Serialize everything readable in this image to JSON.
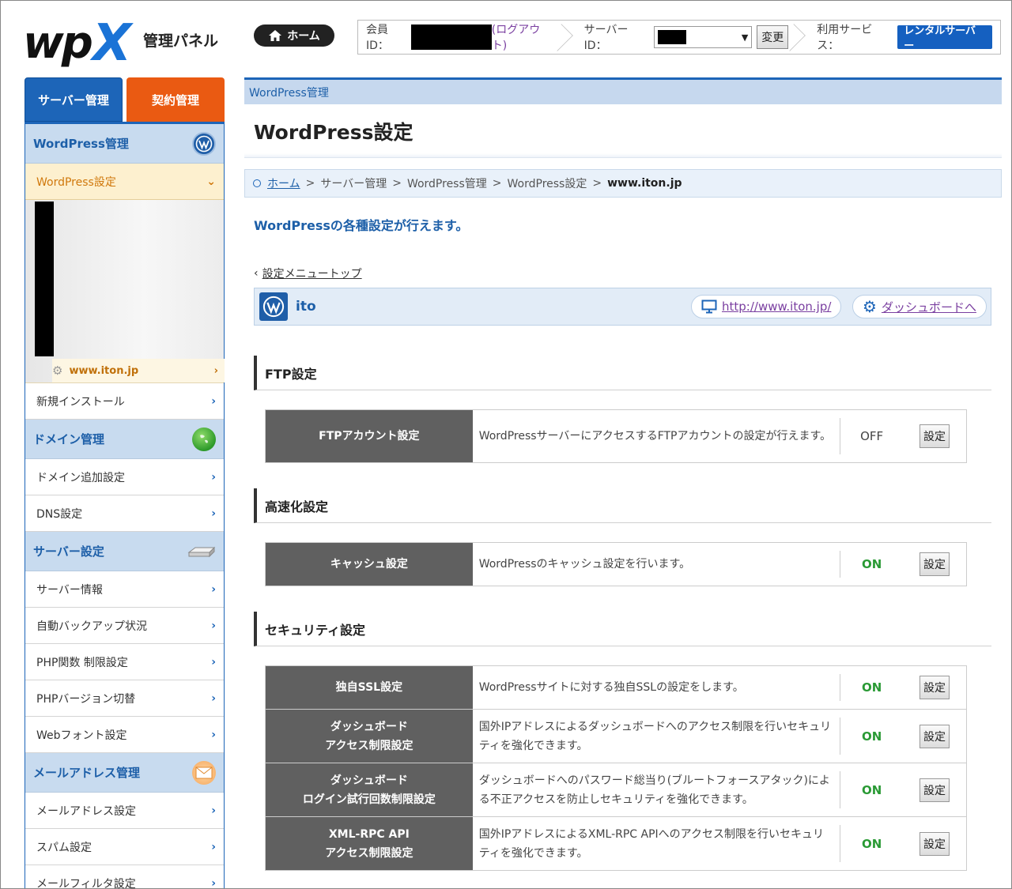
{
  "header": {
    "logo_wp": "wp",
    "logo_x": "X",
    "logo_sub": "管理パネル",
    "home_label": "ホーム",
    "member_id_label": "会員ID：",
    "logout_label": "(ログアウト)",
    "server_id_label": "サーバーID：",
    "change_label": "変更",
    "service_label": "利用サービス：",
    "service_value": "レンタルサーバー"
  },
  "sidebar": {
    "tabs": [
      "サーバー管理",
      "契約管理"
    ],
    "sections": [
      {
        "title": "WordPress管理",
        "icon": "wordpress-icon"
      },
      {
        "title": "ドメイン管理",
        "icon": "globe-icon"
      },
      {
        "title": "サーバー設定",
        "icon": "server-icon"
      },
      {
        "title": "メールアドレス管理",
        "icon": "mail-icon"
      }
    ],
    "wp_setting": "WordPress設定",
    "site_domain": "www.iton.jp",
    "new_install": "新規インストール",
    "domain_items": [
      "ドメイン追加設定",
      "DNS設定"
    ],
    "server_items": [
      "サーバー情報",
      "自動バックアップ状況",
      "PHP関数 制限設定",
      "PHPバージョン切替",
      "Webフォント設定"
    ],
    "mail_items": [
      "メールアドレス設定",
      "スパム設定",
      "メールフィルタ設定"
    ]
  },
  "main": {
    "crumbbar": "WordPress管理",
    "title": "WordPress設定",
    "breadcrumb": [
      "ホーム",
      "サーバー管理",
      "WordPress管理",
      "WordPress設定",
      "www.iton.jp"
    ],
    "lead": "WordPressの各種設定が行えます。",
    "back_link": "設定メニュートップ",
    "site_name": "ito",
    "site_url": "http://www.iton.jp/",
    "dashboard_link": "ダッシュボードへ",
    "set_label": "設定",
    "sections": [
      {
        "title": "FTP設定",
        "rows": [
          {
            "label": "FTPアカウント設定",
            "desc": "WordPressサーバーにアクセスするFTPアカウントの設定が行えます。",
            "status": "OFF"
          }
        ]
      },
      {
        "title": "高速化設定",
        "rows": [
          {
            "label": "キャッシュ設定",
            "desc": "WordPressのキャッシュ設定を行います。",
            "status": "ON"
          }
        ]
      },
      {
        "title": "セキュリティ設定",
        "rows": [
          {
            "label": "独自SSL設定",
            "desc": "WordPressサイトに対する独自SSLの設定をします。",
            "status": "ON"
          },
          {
            "label": "ダッシュボード\nアクセス制限設定",
            "desc": "国外IPアドレスによるダッシュボードへのアクセス制限を行いセキュリティを強化できます。",
            "status": "ON"
          },
          {
            "label": "ダッシュボード\nログイン試行回数制限設定",
            "desc": "ダッシュボードへのパスワード総当り(ブルートフォースアタック)による不正アクセスを防止しセキュリティを強化できます。",
            "status": "ON"
          },
          {
            "label": "XML-RPC API\nアクセス制限設定",
            "desc": "国外IPアドレスによるXML-RPC APIへのアクセス制限を行いセキュリティを強化できます。",
            "status": "ON"
          }
        ]
      }
    ]
  },
  "colors": {
    "primary": "#1d65b8",
    "accent": "#ea5a12",
    "on": "#2a9a35",
    "label_bg": "#606060"
  }
}
